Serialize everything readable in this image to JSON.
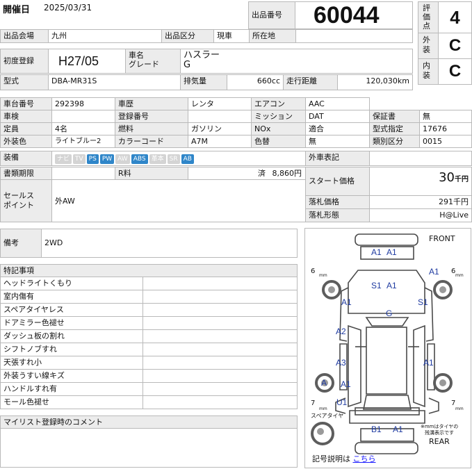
{
  "header": {
    "date_label": "開催日",
    "date_value": "2025/03/31",
    "lot_label": "出品番号",
    "lot_number": "60044",
    "rating_label_1": "評",
    "rating_label_2": "価",
    "rating_label_3": "点",
    "rating_value": "4",
    "exterior_label_1": "外",
    "exterior_label_2": "装",
    "exterior_value": "C",
    "interior_label_1": "内",
    "interior_label_2": "装",
    "interior_value": "C"
  },
  "row_venue": {
    "venue_label": "出品会場",
    "venue_value": "九州",
    "category_label": "出品区分",
    "category_value": "現車",
    "location_label": "所在地",
    "location_value": ""
  },
  "vehicle": {
    "reg_label": "初度登録",
    "reg_value": "H27/05",
    "name_label": "車名",
    "grade_label": "グレード",
    "name_value": "ハスラー",
    "grade_value": "G",
    "model_label": "型式",
    "model_value": "DBA-MR31S",
    "displacement_label": "排気量",
    "displacement_value": "660cc",
    "mileage_label": "走行距離",
    "mileage_value": "120,030km"
  },
  "specs": {
    "chassis_label": "車台番号",
    "chassis_value": "292398",
    "history_label": "車歴",
    "history_value": "レンタ",
    "ac_label": "エアコン",
    "ac_value": "AAC",
    "inspection_label": "車検",
    "inspection_value": "",
    "regno_label": "登録番号",
    "regno_value": "",
    "transmission_label": "ミッション",
    "transmission_value": "DAT",
    "warranty_label": "保証書",
    "warranty_value": "無",
    "capacity_label": "定員",
    "capacity_value": "4名",
    "fuel_label": "燃料",
    "fuel_value": "ガソリン",
    "nox_label": "NOx",
    "nox_value": "適合",
    "typeno_label": "型式指定",
    "typeno_value": "17676",
    "color_label": "外装色",
    "color_value": "ライトブルー2",
    "colorcode_label": "カラーコード",
    "colorcode_value": "A7M",
    "recolor_label": "色替",
    "recolor_value": "無",
    "classno_label": "類別区分",
    "classno_value": "0015",
    "equip_label": "装備",
    "equipment": [
      {
        "name": "ナビ",
        "on": false
      },
      {
        "name": "TV",
        "on": false
      },
      {
        "name": "PS",
        "on": true
      },
      {
        "name": "PW",
        "on": true
      },
      {
        "name": "AW",
        "on": false
      },
      {
        "name": "ABS",
        "on": true
      },
      {
        "name": "革本",
        "on": false
      },
      {
        "name": "SR",
        "on": false
      },
      {
        "name": "AB",
        "on": true
      }
    ],
    "ext_notes_label": "外車表記",
    "ext_notes_value": "",
    "docs_label": "書類期限",
    "docs_value": "",
    "rfee_label": "R料",
    "rfee_status": "済",
    "rfee_value": "8,860円",
    "sales_label_1": "セールス",
    "sales_label_2": "ポイント",
    "sales_value": "外AW"
  },
  "pricing": {
    "start_label": "スタート価格",
    "start_value": "30",
    "start_unit": "千円",
    "sold_label": "落札価格",
    "sold_value": "291千円",
    "sold_type_label": "落札形態",
    "sold_type_value": "H@Live"
  },
  "remarks": {
    "label": "備考",
    "value": "2WD"
  },
  "notes": {
    "title": "特記事項",
    "items": [
      "ヘッドライトくもり",
      "室内傷有",
      "スペアタイヤレス",
      "ドアミラー色褪せ",
      "ダッシュ板の割れ",
      "シフトノブすれ",
      "天張すれ小",
      "外装うすい線キズ",
      "ハンドルすれ有",
      "モール色褪せ"
    ]
  },
  "mylist": {
    "label": "マイリスト登録時のコメント"
  },
  "diagram": {
    "front": "FRONT",
    "rear": "REAR",
    "spare": "スペアタイヤ",
    "note_line1": "※mmはタイヤの",
    "note_line2": "残溝表示です",
    "tire_fl": "6",
    "tire_fr": "6",
    "tire_rl": "7",
    "tire_rr": "7",
    "tire_unit": "mm",
    "legend_prefix": "記号説明は",
    "legend_link": "こちら",
    "marks": {
      "front_bumper_a": "A1",
      "front_bumper_b": "A1",
      "hood_s": "S1",
      "hood_a": "A1",
      "front_right_fender": "A1",
      "left_fender": "A1",
      "right_front_door": "S1",
      "roof": "G",
      "left_front_door": "A2",
      "left_rear_door": "A3",
      "right_rear_door": "A1",
      "left_rear_wheel": "A",
      "left_quarter": "A1",
      "left_rear_bumper": "U1",
      "rear_bumper_b": "B1",
      "rear_bumper_a": "A1"
    }
  }
}
